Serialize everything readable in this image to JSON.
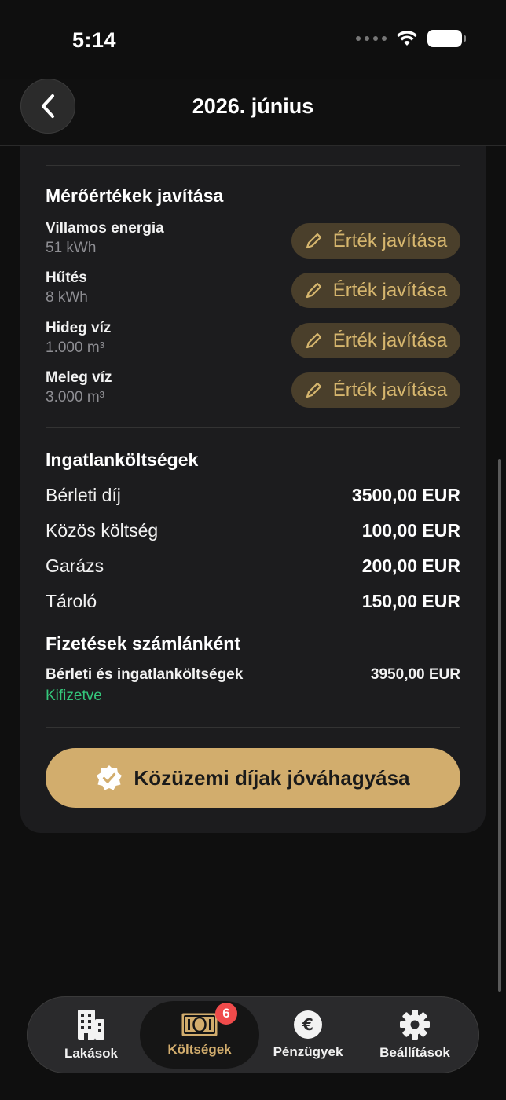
{
  "status_bar": {
    "time": "5:14"
  },
  "header": {
    "title": "2026. június"
  },
  "meters": {
    "title": "Mérőértékek javítása",
    "edit_label": "Érték javítása",
    "items": [
      {
        "name": "Villamos energia",
        "value": "51 kWh"
      },
      {
        "name": "Hűtés",
        "value": "8 kWh"
      },
      {
        "name": "Hideg víz",
        "value": "1.000 m³"
      },
      {
        "name": "Meleg víz",
        "value": "3.000 m³"
      }
    ]
  },
  "property_costs": {
    "title": "Ingatlanköltségek",
    "items": [
      {
        "name": "Bérleti díj",
        "amount": "3500,00 EUR"
      },
      {
        "name": "Közös költség",
        "amount": "100,00 EUR"
      },
      {
        "name": "Garázs",
        "amount": "200,00 EUR"
      },
      {
        "name": "Tároló",
        "amount": "150,00 EUR"
      }
    ]
  },
  "payments": {
    "title": "Fizetések számlánként",
    "items": [
      {
        "name": "Bérleti és ingatlanköltségek",
        "status": "Kifizetve",
        "amount": "3950,00 EUR"
      }
    ]
  },
  "approve_button": {
    "label": "Közüzemi díjak jóváhagyása"
  },
  "tabbar": {
    "tabs": [
      {
        "label": "Lakások",
        "icon": "building-icon",
        "active": false
      },
      {
        "label": "Költségek",
        "icon": "banknote-icon",
        "active": true,
        "badge": "6"
      },
      {
        "label": "Pénzügyek",
        "icon": "euro-icon",
        "active": false
      },
      {
        "label": "Beállítások",
        "icon": "gear-icon",
        "active": false
      }
    ]
  },
  "colors": {
    "accent": "#d2ad6d",
    "accent_dark": "#4a3f2b",
    "paid": "#34c77b",
    "badge": "#f04b4b",
    "card": "#1c1c1e"
  }
}
